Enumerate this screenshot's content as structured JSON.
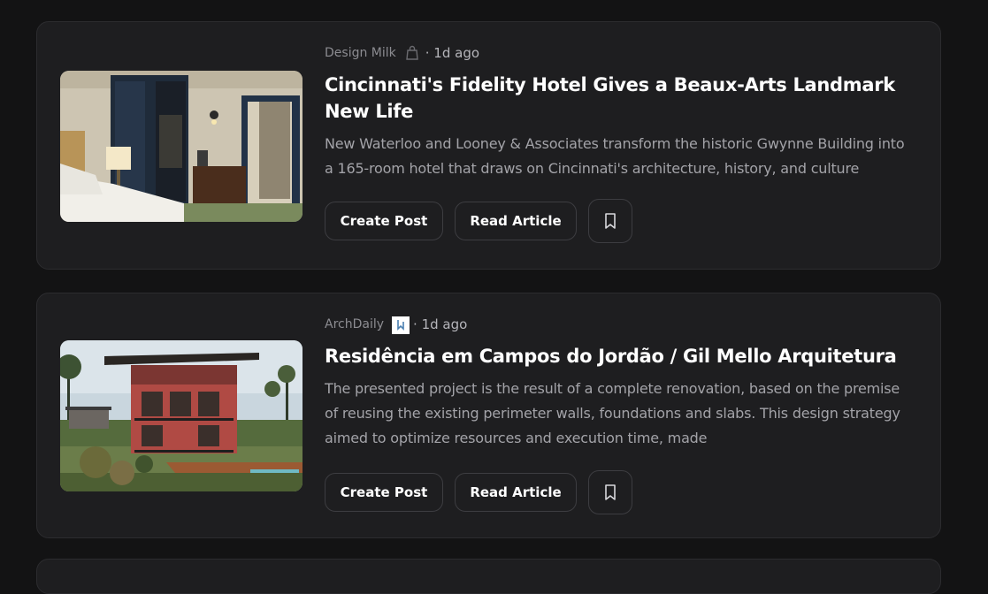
{
  "articles": [
    {
      "source": "Design Milk",
      "source_icon": "shopping-bag-icon",
      "age": "· 1d ago",
      "title": "Cincinnati's Fidelity Hotel Gives a Beaux-Arts Landmark New Life",
      "summary": "New Waterloo and Looney & Associates transform the historic Gwynne Building into a 165-room hotel that draws on Cincinnati's architecture, history, and culture",
      "create_label": "Create Post",
      "read_label": "Read Article",
      "bookmark_icon": "bookmark-icon"
    },
    {
      "source": "ArchDaily",
      "source_icon": "archdaily-logo-icon",
      "age": "· 1d ago",
      "title": "Residência em Campos do Jordão / Gil Mello Arquitetura",
      "summary": "The presented project is the result of a complete renovation, based on the premise of reusing the existing perimeter walls, foundations and slabs. This design strategy aimed to optimize resources and execution time, made",
      "create_label": "Create Post",
      "read_label": "Read Article",
      "bookmark_icon": "bookmark-icon"
    }
  ],
  "colors": {
    "background": "#131314",
    "card": "#1e1e20",
    "border": "#2c2c2f",
    "title": "#ffffff",
    "muted": "#a3a3a8"
  }
}
